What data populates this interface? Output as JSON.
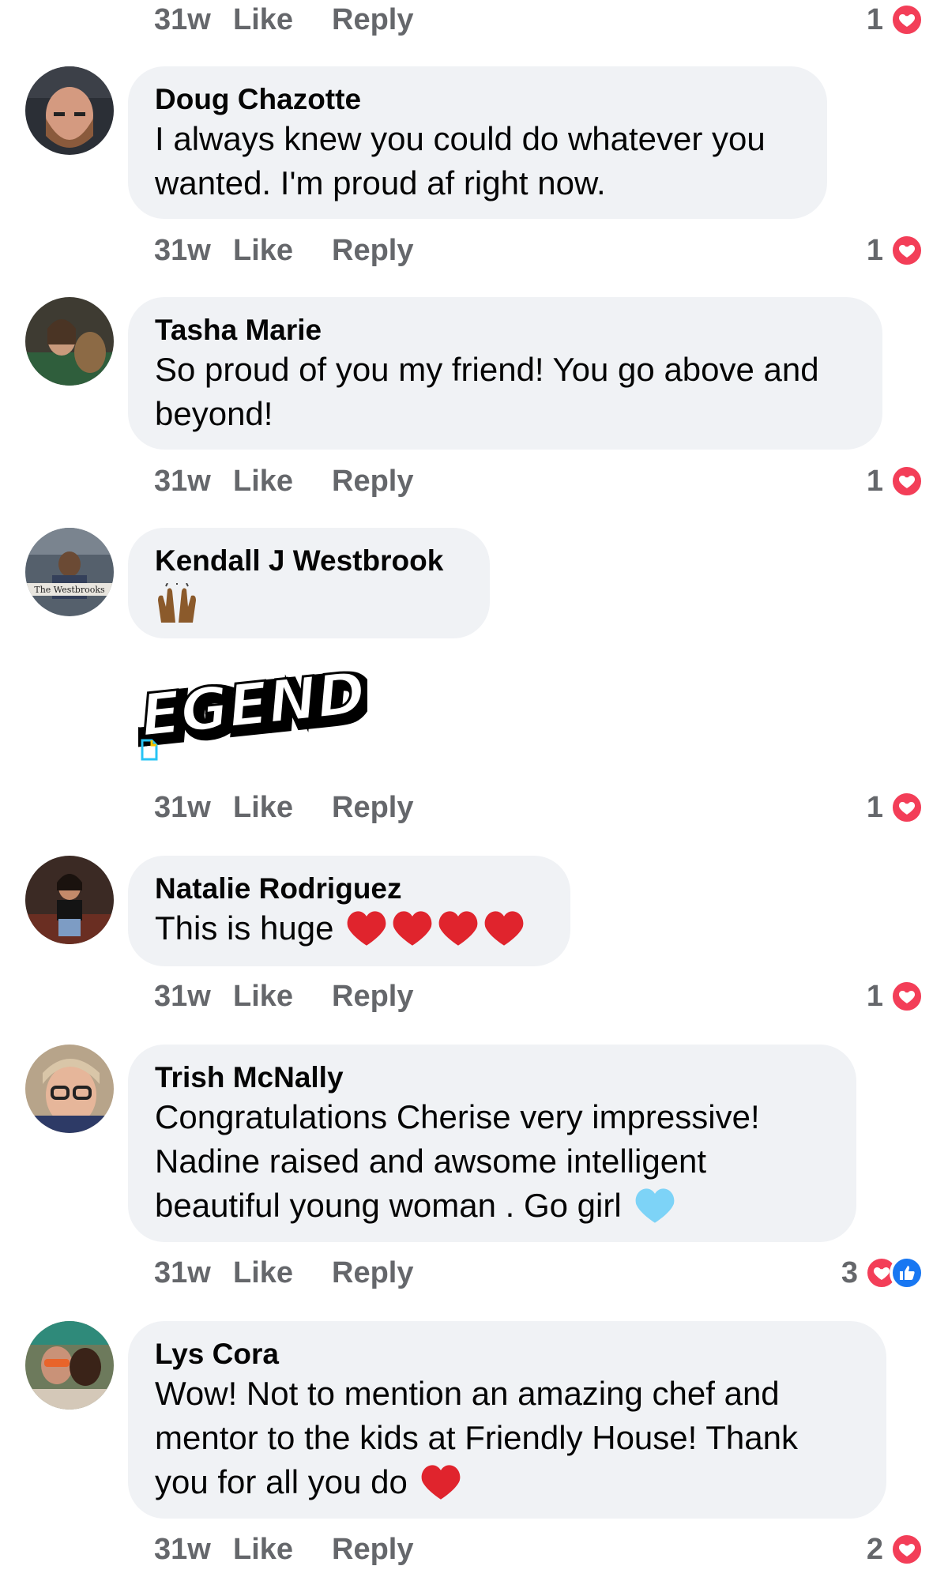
{
  "common": {
    "time": "31w",
    "like": "Like",
    "reply": "Reply"
  },
  "comments": [
    {
      "count": "1"
    },
    {
      "name": "Doug Chazotte",
      "lines": [
        "I always knew you could do whatever you",
        "wanted. I'm proud af right now."
      ],
      "count": "1"
    },
    {
      "name": "Tasha Marie",
      "lines": [
        "So proud of you my friend! You go above and",
        "beyond!"
      ],
      "count": "1"
    },
    {
      "name": "Kendall J Westbrook",
      "emoji": "raising-hands-emoji",
      "sticker_text": "LEGEND!",
      "avatar_caption": "The Westbrooks",
      "count": "1"
    },
    {
      "name": "Natalie Rodriguez",
      "text": "This is huge",
      "count": "1"
    },
    {
      "name": "Trish McNally",
      "lines": [
        "Congratulations Cherise  very impressive!",
        "Nadine raised and awsome intelligent",
        "beautiful young woman . Go girl"
      ],
      "count": "3"
    },
    {
      "name": "Lys Cora",
      "lines": [
        "Wow! Not to mention an amazing chef and",
        "mentor to the kids at Friendly House! Thank",
        "you for all you do"
      ],
      "count": "2"
    }
  ],
  "colors": {
    "bubble": "#f0f2f5",
    "meta": "#65676b",
    "love": "#f33e58",
    "like": "#1877f2",
    "heart_emoji": "#e0242d",
    "blue_heart": "#7dd3f7"
  }
}
